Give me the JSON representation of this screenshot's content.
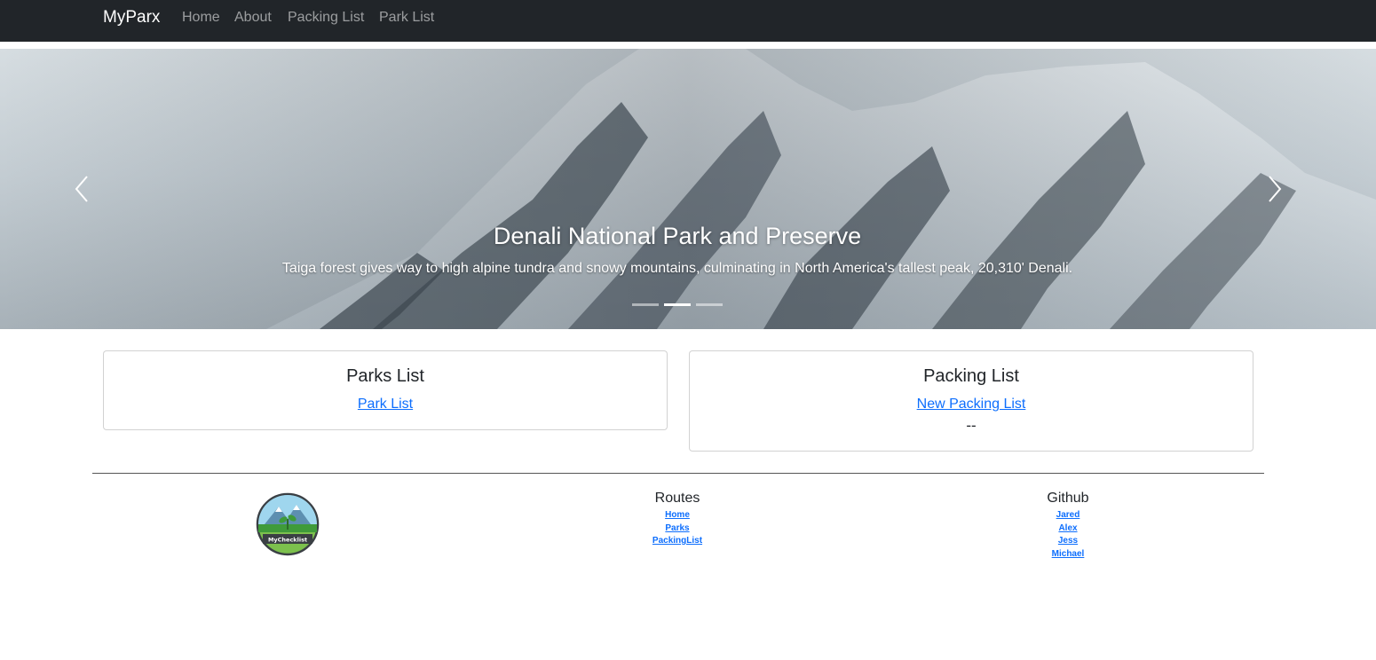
{
  "navbar": {
    "brand": "MyParx",
    "links": [
      "Home",
      "About",
      "Packing List",
      "Park List"
    ]
  },
  "carousel": {
    "title": "Denali National Park and Preserve",
    "text": "Taiga forest gives way to high alpine tundra and snowy mountains, culminating in North America's tallest peak, 20,310' Denali.",
    "slide_count": 3,
    "active_index": 1,
    "prev_icon": "chevron-left-icon",
    "next_icon": "chevron-right-icon"
  },
  "cards": {
    "parks": {
      "title": "Parks List",
      "link": "Park List"
    },
    "packing": {
      "title": "Packing List",
      "link": "New Packing List",
      "empty": "--"
    }
  },
  "footer": {
    "logo_text": "MyChecklist",
    "routes": {
      "title": "Routes",
      "links": [
        "Home",
        "Parks",
        "PackingList"
      ]
    },
    "github": {
      "title": "Github",
      "links": [
        "Jared",
        "Alex",
        "Jess",
        "Michael"
      ]
    }
  },
  "colors": {
    "navbar_bg": "#212529",
    "link": "#0d6efd",
    "nav_link": "rgba(255,255,255,0.55)"
  }
}
